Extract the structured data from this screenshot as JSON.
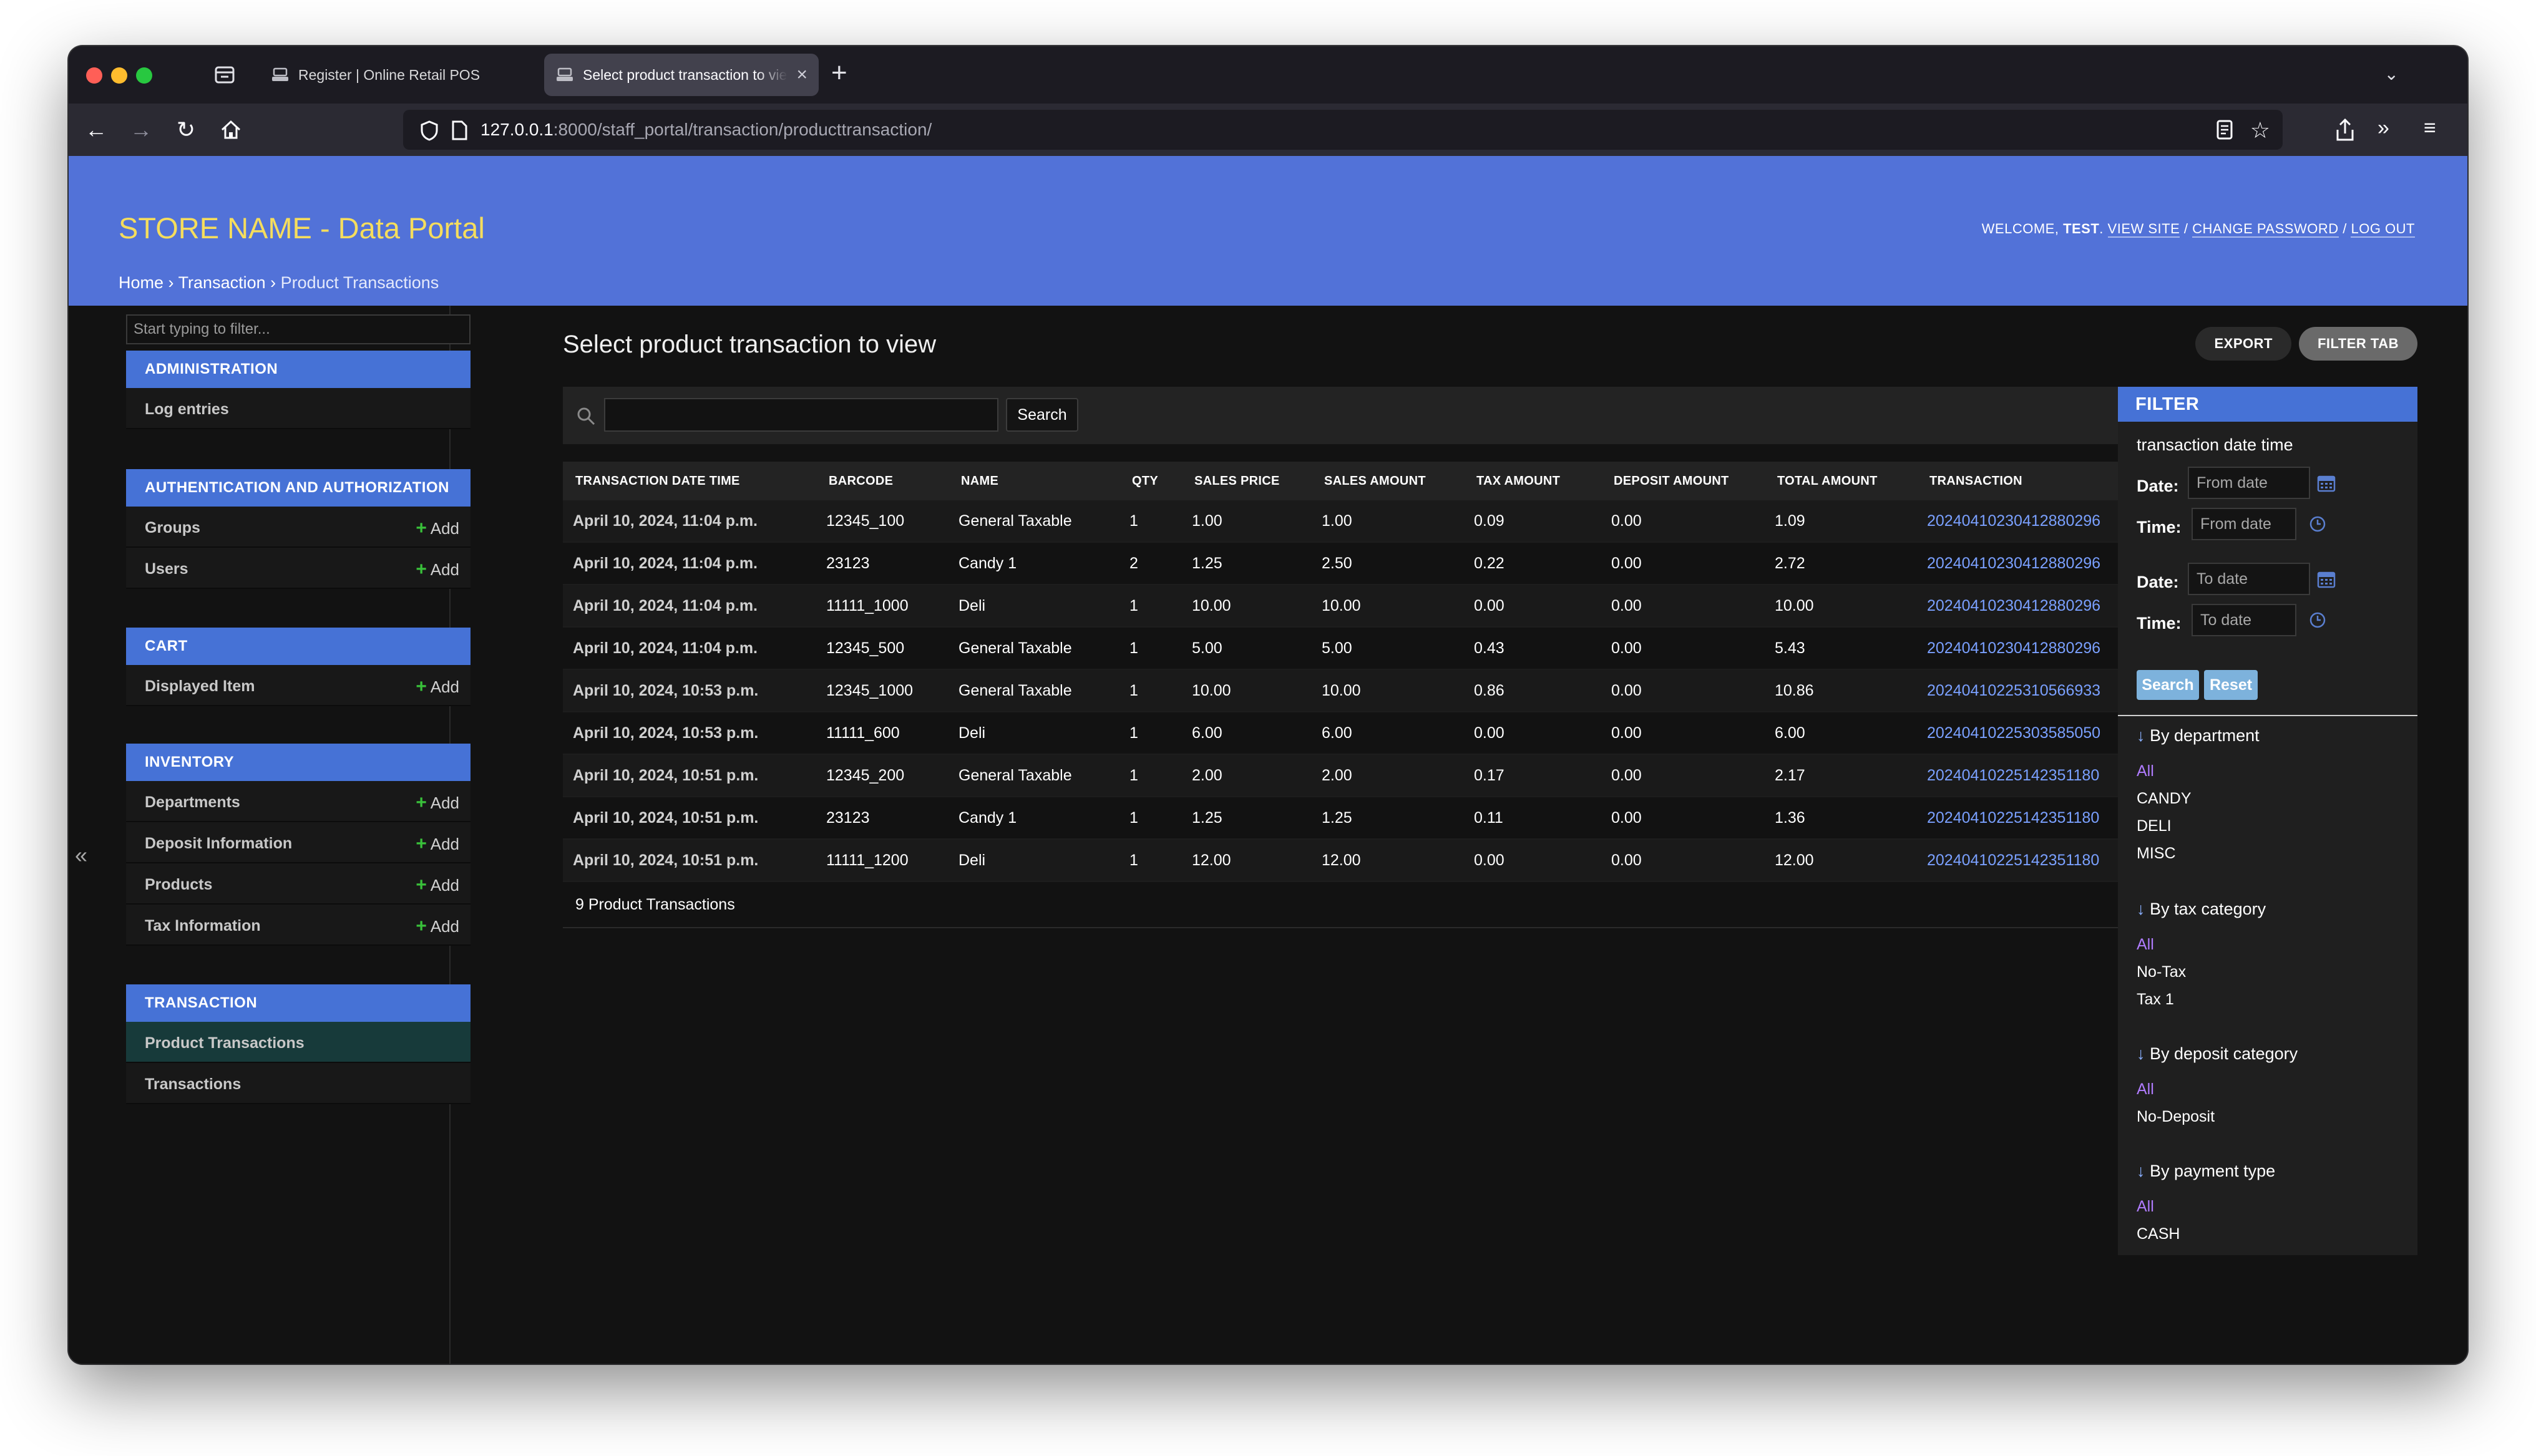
{
  "browser": {
    "tabs": [
      {
        "title": "Register | Online Retail POS",
        "active": false
      },
      {
        "title": "Select product transaction to view",
        "active": true
      }
    ],
    "url_host": "127.0.0.1",
    "url_rest": ":8000/staff_portal/transaction/producttransaction/"
  },
  "header": {
    "branding": "STORE NAME - Data Portal",
    "welcome": "WELCOME,",
    "user": "TEST",
    "view_site": "VIEW SITE",
    "change_password": "CHANGE PASSWORD",
    "log_out": "LOG OUT",
    "separator": "/",
    "breadcrumbs": [
      "Home",
      "Transaction",
      "Product Transactions"
    ],
    "breadcrumb_sep": "›"
  },
  "sidebar": {
    "filter_placeholder": "Start typing to filter...",
    "toggle": "«",
    "add_label": "Add",
    "apps": [
      {
        "caption": "ADMINISTRATION",
        "models": [
          {
            "name": "Log entries",
            "add": false
          }
        ]
      },
      {
        "caption": "AUTHENTICATION AND AUTHORIZATION",
        "models": [
          {
            "name": "Groups",
            "add": true
          },
          {
            "name": "Users",
            "add": true
          }
        ]
      },
      {
        "caption": "CART",
        "models": [
          {
            "name": "Displayed Item",
            "add": true
          }
        ]
      },
      {
        "caption": "INVENTORY",
        "models": [
          {
            "name": "Departments",
            "add": true
          },
          {
            "name": "Deposit Information",
            "add": true
          },
          {
            "name": "Products",
            "add": true
          },
          {
            "name": "Tax Information",
            "add": true
          }
        ]
      },
      {
        "caption": "TRANSACTION",
        "models": [
          {
            "name": "Product Transactions",
            "add": false,
            "selected": true
          },
          {
            "name": "Transactions",
            "add": false
          }
        ]
      }
    ]
  },
  "main": {
    "title": "Select product transaction to view",
    "export_label": "EXPORT",
    "filter_tab_label": "FILTER TAB",
    "search_button": "Search",
    "columns": [
      "TRANSACTION DATE TIME",
      "BARCODE",
      "NAME",
      "QTY",
      "SALES PRICE",
      "SALES AMOUNT",
      "TAX AMOUNT",
      "DEPOSIT AMOUNT",
      "TOTAL AMOUNT",
      "TRANSACTION"
    ],
    "rows": [
      [
        "April 10, 2024, 11:04 p.m.",
        "12345_100",
        "General Taxable",
        "1",
        "1.00",
        "1.00",
        "0.09",
        "0.00",
        "1.09",
        "20240410230412880296"
      ],
      [
        "April 10, 2024, 11:04 p.m.",
        "23123",
        "Candy 1",
        "2",
        "1.25",
        "2.50",
        "0.22",
        "0.00",
        "2.72",
        "20240410230412880296"
      ],
      [
        "April 10, 2024, 11:04 p.m.",
        "11111_1000",
        "Deli",
        "1",
        "10.00",
        "10.00",
        "0.00",
        "0.00",
        "10.00",
        "20240410230412880296"
      ],
      [
        "April 10, 2024, 11:04 p.m.",
        "12345_500",
        "General Taxable",
        "1",
        "5.00",
        "5.00",
        "0.43",
        "0.00",
        "5.43",
        "20240410230412880296"
      ],
      [
        "April 10, 2024, 10:53 p.m.",
        "12345_1000",
        "General Taxable",
        "1",
        "10.00",
        "10.00",
        "0.86",
        "0.00",
        "10.86",
        "20240410225310566933"
      ],
      [
        "April 10, 2024, 10:53 p.m.",
        "11111_600",
        "Deli",
        "1",
        "6.00",
        "6.00",
        "0.00",
        "0.00",
        "6.00",
        "20240410225303585050"
      ],
      [
        "April 10, 2024, 10:51 p.m.",
        "12345_200",
        "General Taxable",
        "1",
        "2.00",
        "2.00",
        "0.17",
        "0.00",
        "2.17",
        "20240410225142351180"
      ],
      [
        "April 10, 2024, 10:51 p.m.",
        "23123",
        "Candy 1",
        "1",
        "1.25",
        "1.25",
        "0.11",
        "0.00",
        "1.36",
        "20240410225142351180"
      ],
      [
        "April 10, 2024, 10:51 p.m.",
        "11111_1200",
        "Deli",
        "1",
        "12.00",
        "12.00",
        "0.00",
        "0.00",
        "12.00",
        "20240410225142351180"
      ]
    ],
    "result_count": "9 Product Transactions"
  },
  "filter": {
    "caption": "FILTER",
    "date_section": "transaction date time",
    "date_label": "Date:",
    "time_label": "Time:",
    "from_date_placeholder": "From date",
    "from_time_placeholder": "From date",
    "to_date_placeholder": "To date",
    "to_time_placeholder": "To date",
    "search_button": "Search",
    "reset_button": "Reset",
    "arrow": "↓",
    "groups": [
      {
        "title": "By department",
        "options": [
          "All",
          "CANDY",
          "DELI",
          "MISC"
        ]
      },
      {
        "title": "By tax category",
        "options": [
          "All",
          "No-Tax",
          "Tax 1"
        ]
      },
      {
        "title": "By deposit category",
        "options": [
          "All",
          "No-Deposit"
        ]
      },
      {
        "title": "By payment type",
        "options": [
          "All",
          "CASH"
        ]
      }
    ]
  },
  "colors": {
    "header_bg": "#5272d8",
    "branding": "#f5dd5d",
    "module_caption": "#4672d6",
    "link": "#7aa0ff",
    "selected_filter": "#b07cff",
    "add_plus": "#39c13a"
  }
}
